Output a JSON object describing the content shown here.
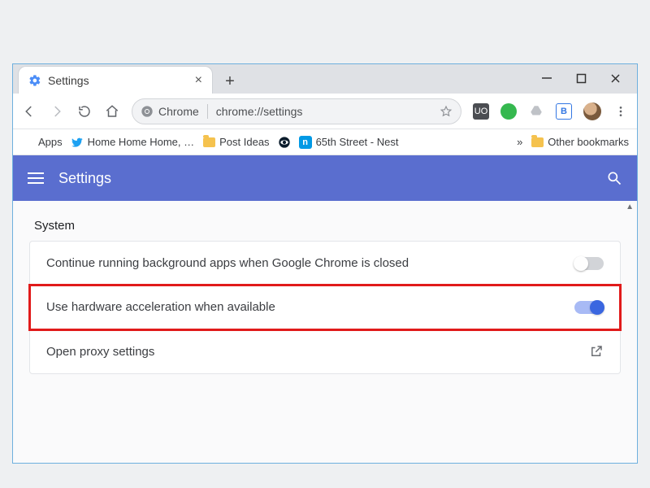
{
  "window": {
    "min_label": "–",
    "max_label": "☐",
    "close_label": "✕"
  },
  "tab": {
    "title": "Settings",
    "close": "×",
    "newtab": "+"
  },
  "omnibox": {
    "protocol_label": "Chrome",
    "url": "chrome://settings"
  },
  "bookmarks": {
    "apps": "Apps",
    "home_cluster": "Home Home Home, …",
    "post_ideas": "Post Ideas",
    "nest": "65th Street - Nest",
    "overflow": "»",
    "other": "Other bookmarks"
  },
  "settings": {
    "title": "Settings",
    "section": "System",
    "rows": {
      "bgapps": {
        "label": "Continue running background apps when Google Chrome is closed",
        "state": "off"
      },
      "hwaccel": {
        "label": "Use hardware acceleration when available",
        "state": "on"
      },
      "proxy": {
        "label": "Open proxy settings"
      }
    }
  }
}
